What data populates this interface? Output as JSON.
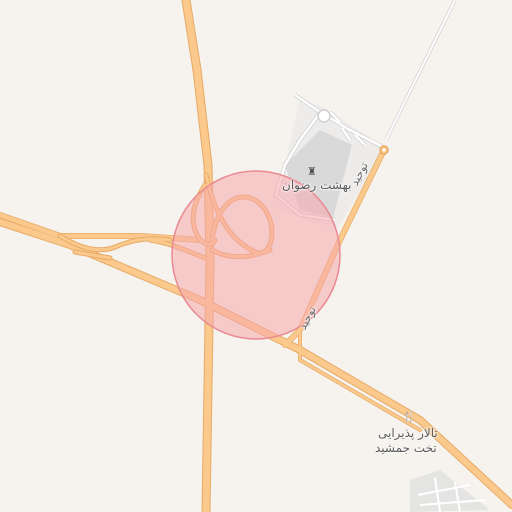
{
  "map": {
    "area_highlight": {
      "fill": "#f7a8ad",
      "stroke": "#e98a93",
      "opacity": 0.55
    },
    "colors": {
      "background": "#f6f3ee",
      "major_road": "#fbc98c",
      "major_road_casing": "#e9ad68",
      "minor_road": "#ffffff",
      "minor_road_casing": "#d3d3d3",
      "building": "#e3e3e3"
    },
    "pois": [
      {
        "name": "بهشت رضوان",
        "icon": "cemetery-icon",
        "glyph": "♜"
      },
      {
        "name_line1": "تالار پذیرایی",
        "name_line2": "تخت جمشید",
        "icon": "restaurant-icon",
        "glyph": "🍴"
      }
    ],
    "road_labels": [
      "توحید",
      "توحید"
    ]
  }
}
